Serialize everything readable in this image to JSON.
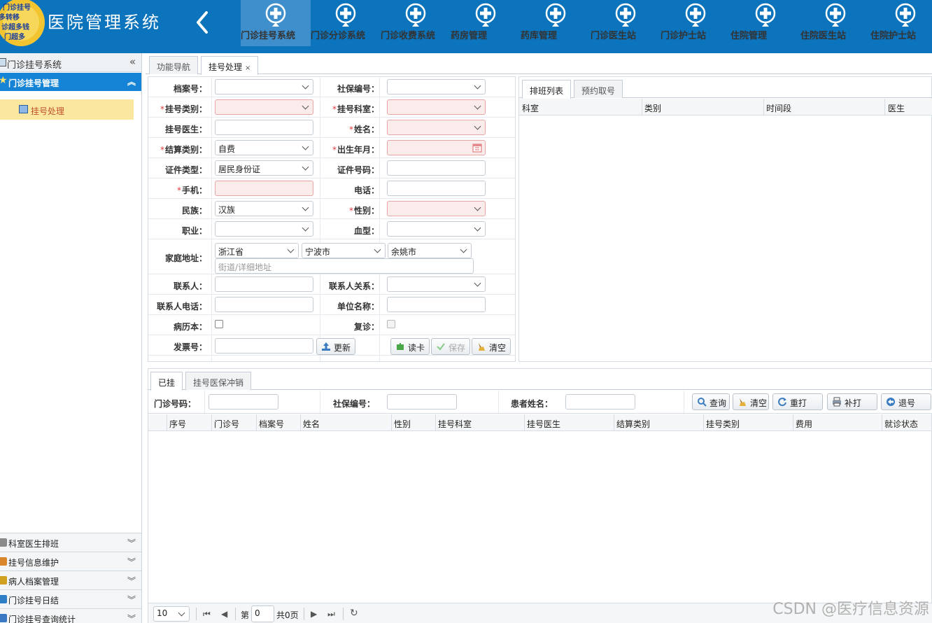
{
  "app": {
    "title": "医院管理系统",
    "logo_text": [
      "门诊挂号",
      "多转移",
      "诊超多钱",
      "门超多"
    ]
  },
  "nav": [
    {
      "label": "门诊挂号系统",
      "active": true
    },
    {
      "label": "门诊分诊系统"
    },
    {
      "label": "门诊收费系统"
    },
    {
      "label": "药房管理"
    },
    {
      "label": "药库管理"
    },
    {
      "label": "门诊医生站"
    },
    {
      "label": "门诊护士站"
    },
    {
      "label": "住院管理"
    },
    {
      "label": "住院医生站"
    },
    {
      "label": "住院护士站"
    }
  ],
  "sidebar": {
    "title": "门诊挂号系统",
    "section": "门诊挂号管理",
    "active_item": "挂号处理",
    "accordions": [
      "科室医生排班",
      "挂号信息维护",
      "病人档案管理",
      "门诊挂号日结",
      "门诊挂号查询统计"
    ]
  },
  "tabs": [
    {
      "label": "功能导航"
    },
    {
      "label": "挂号处理",
      "close": "×"
    }
  ],
  "form": {
    "required_mark": "*",
    "separator": "：",
    "file_no": "档案号",
    "si_no": "社保编号",
    "reg_type": "挂号类别",
    "reg_dept": "挂号科室",
    "reg_doctor": "挂号医生",
    "name": "姓名",
    "settle_type": "结算类别",
    "settle_value": "自费",
    "birth": "出生年月",
    "id_type": "证件类型",
    "id_type_value": "居民身份证",
    "id_no": "证件号码",
    "mobile": "手机",
    "phone": "电话",
    "ethnic": "民族",
    "ethnic_value": "汉族",
    "gender": "性别",
    "job": "职业",
    "blood": "血型",
    "address": "家庭地址",
    "province": "浙江省",
    "city": "宁波市",
    "county": "余姚市",
    "street_placeholder": "街道/详细地址",
    "contact": "联系人",
    "contact_rel": "联系人关系",
    "contact_phone": "联系人电话",
    "employer": "单位名称",
    "record_book": "病历本",
    "revisit": "复诊",
    "invoice": "发票号",
    "btn_update": "更新",
    "btn_read": "读卡",
    "btn_save": "保存",
    "btn_clear": "清空"
  },
  "schedule": {
    "tabs": [
      "排班列表",
      "预约取号"
    ],
    "columns": [
      "科室",
      "类别",
      "时间段",
      "医生"
    ]
  },
  "lower": {
    "tabs": [
      "已挂",
      "挂号医保冲销"
    ],
    "search": {
      "clinic_no": "门诊号码",
      "si_no": "社保编号",
      "patient_name": "患者姓名",
      "btn_query": "查询",
      "btn_clear": "清空",
      "btn_reprint": "重打",
      "btn_supplement": "补打",
      "btn_refund": "退号"
    },
    "columns": [
      "序号",
      "门诊号",
      "档案号",
      "姓名",
      "性别",
      "挂号科室",
      "挂号医生",
      "结算类别",
      "挂号类别",
      "费用",
      "就诊状态"
    ],
    "pager": {
      "page_size": "10",
      "page_prefix": "第",
      "page_value": "0",
      "total": "共0页"
    }
  },
  "watermark": "CSDN @医疗信息资源"
}
